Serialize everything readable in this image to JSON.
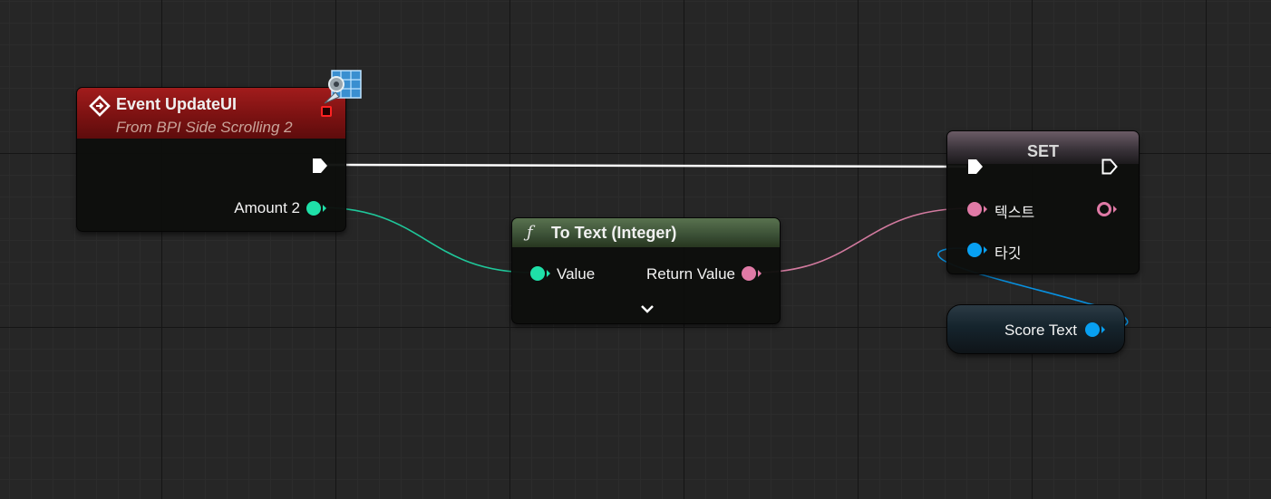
{
  "event_node": {
    "title": "Event UpdateUI",
    "subtitle": "From BPI Side Scrolling 2",
    "output_pin_label": "Amount 2",
    "icon": "event-diamond-icon",
    "badge_icon": "blueprint-interface-icon"
  },
  "to_text_node": {
    "function_symbol": "ƒ",
    "title": "To Text (Integer)",
    "input_pin_label": "Value",
    "output_pin_label": "Return Value",
    "expand_icon": "chevron-down-icon"
  },
  "set_node": {
    "title": "SET",
    "text_pin_label": "텍스트",
    "target_pin_label": "타깃"
  },
  "variable_node": {
    "label": "Score Text"
  },
  "colors": {
    "exec_wire": "#ffffff",
    "integer_pin": "#1fe0a8",
    "text_pin": "#e07aa6",
    "object_pin": "#08a0f2",
    "event_header": "#8a1515",
    "function_header": "#4a6340"
  }
}
